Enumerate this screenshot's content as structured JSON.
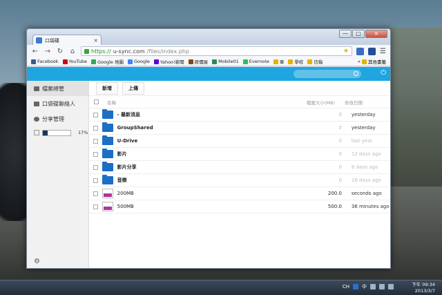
{
  "browser": {
    "tab_title": "口袋碟",
    "tab_close": "×",
    "window_buttons": {
      "minimize": "—",
      "maximize": "□",
      "close": "×"
    },
    "nav": {
      "back": "←",
      "forward": "→",
      "reload": "↻",
      "home": "⌂"
    },
    "url": {
      "scheme": "https://",
      "host": "u-sync.com",
      "path": "/files/index.php"
    },
    "bookmarks": [
      {
        "label": "Facebook",
        "color": "#3b5998"
      },
      {
        "label": "YouTube",
        "color": "#d0021b"
      },
      {
        "label": "Google 地圖",
        "color": "#34a853"
      },
      {
        "label": "Google",
        "color": "#4285f4"
      },
      {
        "label": "Yahoo!新聞",
        "color": "#6001d2"
      },
      {
        "label": "原價屋",
        "color": "#8b4513"
      },
      {
        "label": "Mobile01",
        "color": "#2e8b57"
      },
      {
        "label": "Evernote",
        "color": "#2dbe60"
      },
      {
        "label": "車",
        "color": "#e0b400"
      },
      {
        "label": "學校",
        "color": "#e0b400"
      },
      {
        "label": "信箱",
        "color": "#e0b400"
      }
    ],
    "bookmarks_overflow": "»",
    "other_bookmarks": "其他書籤"
  },
  "app": {
    "header_color": "#1fa6e0",
    "search_placeholder": "",
    "power_icon": "⏻",
    "sidebar": {
      "items": [
        {
          "label": "檔案總管"
        },
        {
          "label": "口袋碟聯絡人"
        },
        {
          "label": "分享管理"
        }
      ],
      "quota_percent": 17,
      "quota_label": "17%",
      "settings_icon": "⚙"
    },
    "actions": {
      "new_label": "新增",
      "upload_label": "上傳"
    },
    "table": {
      "headers": {
        "name": "名稱",
        "size": "檔案大小(MB)",
        "date": "修改日期"
      },
      "rows": [
        {
          "type": "folder",
          "name": "- 最新消息",
          "size": "0",
          "date": "yesterday",
          "muted": false
        },
        {
          "type": "folder",
          "name": "GroupShared",
          "size": "0",
          "date": "yesterday",
          "muted": false
        },
        {
          "type": "folder",
          "name": "U-Drive",
          "size": "0",
          "date": "last year",
          "muted": true
        },
        {
          "type": "folder",
          "name": "影片",
          "size": "0",
          "date": "12 days ago",
          "muted": true
        },
        {
          "type": "folder",
          "name": "影片分享",
          "size": "0",
          "date": "8 days ago",
          "muted": true
        },
        {
          "type": "folder",
          "name": "音樂",
          "size": "0",
          "date": "16 days ago",
          "muted": true
        },
        {
          "type": "rar",
          "name": "200MB",
          "size": "200.0",
          "date": "seconds ago",
          "muted": false
        },
        {
          "type": "rar",
          "name": "500MB",
          "size": "500.0",
          "date": "36 minutes ago",
          "muted": false
        }
      ]
    }
  },
  "taskbar": {
    "ime_label": "CH",
    "ime_mode": "中",
    "clock_time": "下午 09:34",
    "clock_date": "2013/3/7"
  }
}
